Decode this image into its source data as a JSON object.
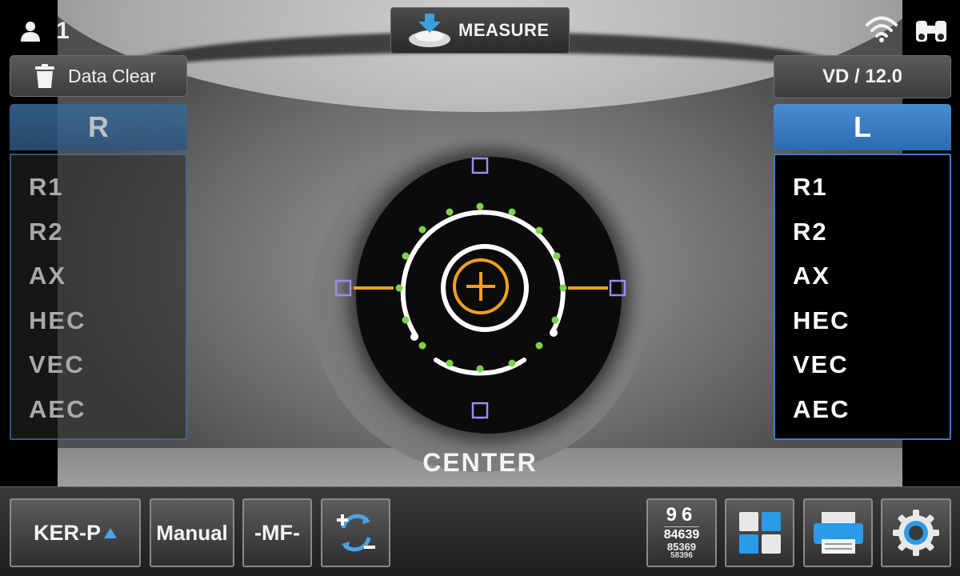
{
  "header": {
    "user_count": "1",
    "measure_label": "MEASURE",
    "data_clear_label": "Data Clear",
    "vd_label": "VD  /  12.0"
  },
  "right_eye_panel": {
    "header": "R",
    "rows": [
      "R1",
      "R2",
      "AX",
      "HEC",
      "VEC",
      "AEC"
    ]
  },
  "left_eye_panel": {
    "header": "L",
    "rows": [
      "R1",
      "R2",
      "AX",
      "HEC",
      "VEC",
      "AEC"
    ]
  },
  "status_label": "CENTER",
  "toolbar": {
    "mode_label": "KER-P",
    "manual_label": "Manual",
    "mf_label": "-MF-",
    "counter": {
      "line1": "96",
      "line2": "84639",
      "line3": "85369",
      "line4": "58396"
    }
  },
  "colors": {
    "accent_blue": "#3a7fc4",
    "target_orange": "#f0a020",
    "alignment_green": "#7ed04a",
    "marker_purple": "#9a8cf0"
  },
  "icons": [
    "user-icon",
    "measure-icon",
    "wifi-icon",
    "binocular-icon",
    "trash-icon",
    "zoom-cycle-icon",
    "layout-grid-icon",
    "printer-icon",
    "gear-icon"
  ]
}
